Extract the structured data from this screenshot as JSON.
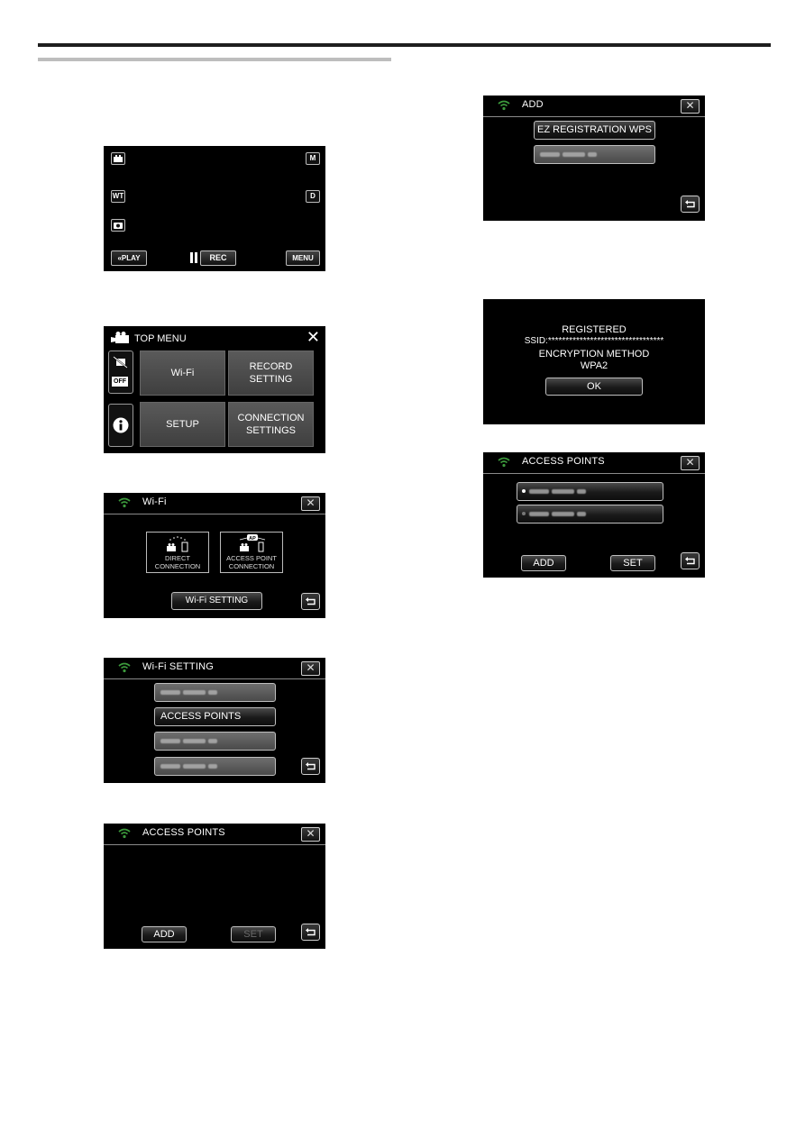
{
  "page": {
    "header_rule_color": "#1e1e1e",
    "subheader_rule_color": "#bdbdbd"
  },
  "screens": {
    "record": {
      "icons": {
        "mode": "video-mode-icon",
        "wt": "WT",
        "snapshot": "camera-icon",
        "m": "M",
        "d": "D"
      },
      "play_label": "PLAY",
      "rec_label": "REC",
      "menu_label": "MENU"
    },
    "top_menu": {
      "title": "TOP MENU",
      "side_off": "OFF",
      "tiles": [
        {
          "label": "Wi-Fi"
        },
        {
          "label": "RECORD SETTING"
        },
        {
          "label": "SETUP"
        },
        {
          "label": "CONNECTION SETTINGS"
        }
      ]
    },
    "wifi": {
      "title": "Wi-Fi",
      "direct_label": "DIRECT CONNECTION",
      "ap_label": "ACCESS POINT CONNECTION",
      "ap_badge": "AP",
      "setting_button": "Wi-Fi SETTING"
    },
    "wifi_setting": {
      "title": "Wi-Fi SETTING",
      "items": [
        {
          "label": "",
          "blurred": true
        },
        {
          "label": "ACCESS POINTS",
          "blurred": false
        },
        {
          "label": "",
          "blurred": true
        },
        {
          "label": "",
          "blurred": true
        }
      ]
    },
    "access_points_empty": {
      "title": "ACCESS POINTS",
      "add_label": "ADD",
      "set_label": "SET"
    },
    "add": {
      "title": "ADD",
      "items": [
        {
          "label": "EZ REGISTRATION WPS",
          "blurred": false
        },
        {
          "label": "",
          "blurred": true
        }
      ]
    },
    "registered": {
      "line1": "REGISTERED",
      "line2": "SSID:*********************************",
      "line3": "ENCRYPTION METHOD",
      "line4": "WPA2",
      "ok_label": "OK"
    },
    "access_points_list": {
      "title": "ACCESS POINTS",
      "entries": [
        {
          "selected": true
        },
        {
          "selected": false
        }
      ],
      "add_label": "ADD",
      "set_label": "SET"
    }
  },
  "colors": {
    "wifi_green": "#3c9a3c",
    "screen_bg": "#000000"
  }
}
